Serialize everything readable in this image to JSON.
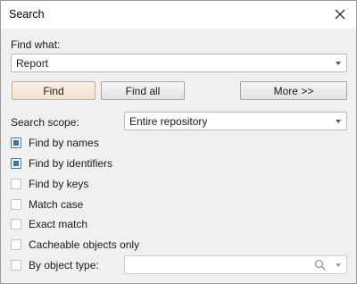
{
  "window": {
    "title": "Search"
  },
  "find_what": {
    "label": "Find what:",
    "value": "Report"
  },
  "buttons": {
    "find": "Find",
    "find_all": "Find all",
    "more": "More >>"
  },
  "scope": {
    "label": "Search scope:",
    "value": "Entire repository"
  },
  "options": [
    {
      "label": "Find by names",
      "checked": true
    },
    {
      "label": "Find by identifiers",
      "checked": true
    },
    {
      "label": "Find by keys",
      "checked": false
    },
    {
      "label": "Match case",
      "checked": false
    },
    {
      "label": "Exact match",
      "checked": false
    },
    {
      "label": "Cacheable objects only",
      "checked": false
    },
    {
      "label": "By object type:",
      "checked": false
    }
  ],
  "object_type": {
    "value": ""
  },
  "colors": {
    "accent": "#2f76b6",
    "default_button_border": "#d9a877"
  }
}
